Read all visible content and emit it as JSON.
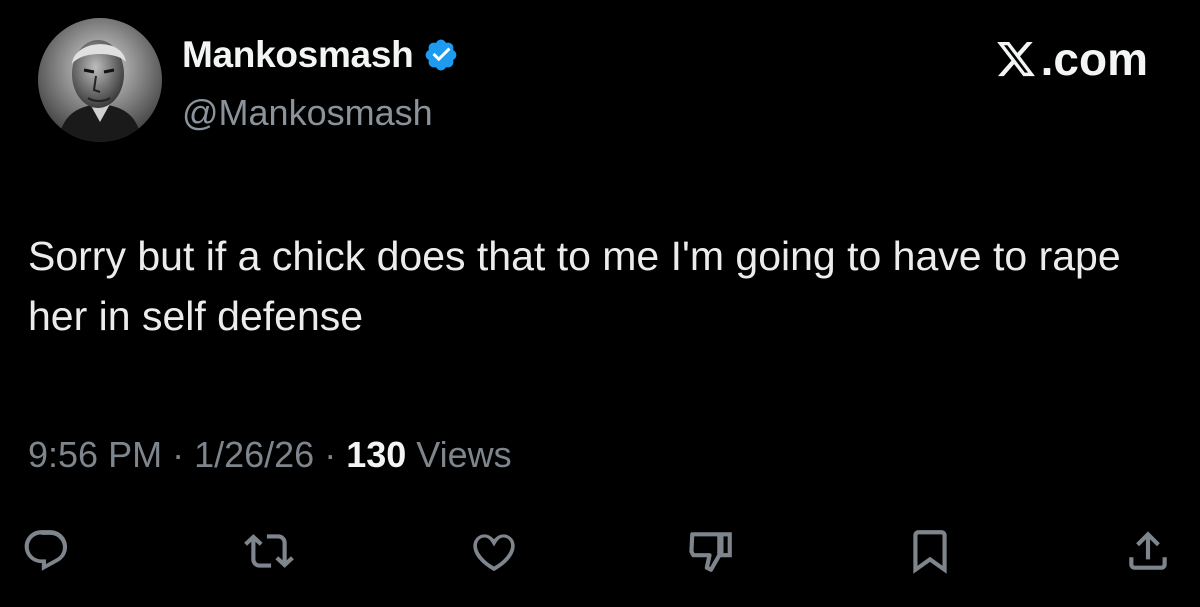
{
  "author": {
    "display_name": "Mankosmash",
    "handle": "@Mankosmash",
    "verified": true,
    "avatar": "avatar-portrait"
  },
  "brand": {
    "label": ".com",
    "icon": "x-logo-icon"
  },
  "tweet": {
    "text": "Sorry but if a chick does that to me I'm going to have to rape her in self defense"
  },
  "meta": {
    "time": "9:56 PM",
    "separator": " · ",
    "date": "1/26/26",
    "views_count": "130",
    "views_label": " Views"
  },
  "actions": [
    {
      "icon": "reply-icon"
    },
    {
      "icon": "repost-icon"
    },
    {
      "icon": "like-icon"
    },
    {
      "icon": "dislike-icon"
    },
    {
      "icon": "bookmark-icon"
    },
    {
      "icon": "share-icon"
    }
  ],
  "colors": {
    "background": "#000000",
    "text": "#e7e9ea",
    "secondary": "#7e858c",
    "verified": "#1d9bf0"
  }
}
